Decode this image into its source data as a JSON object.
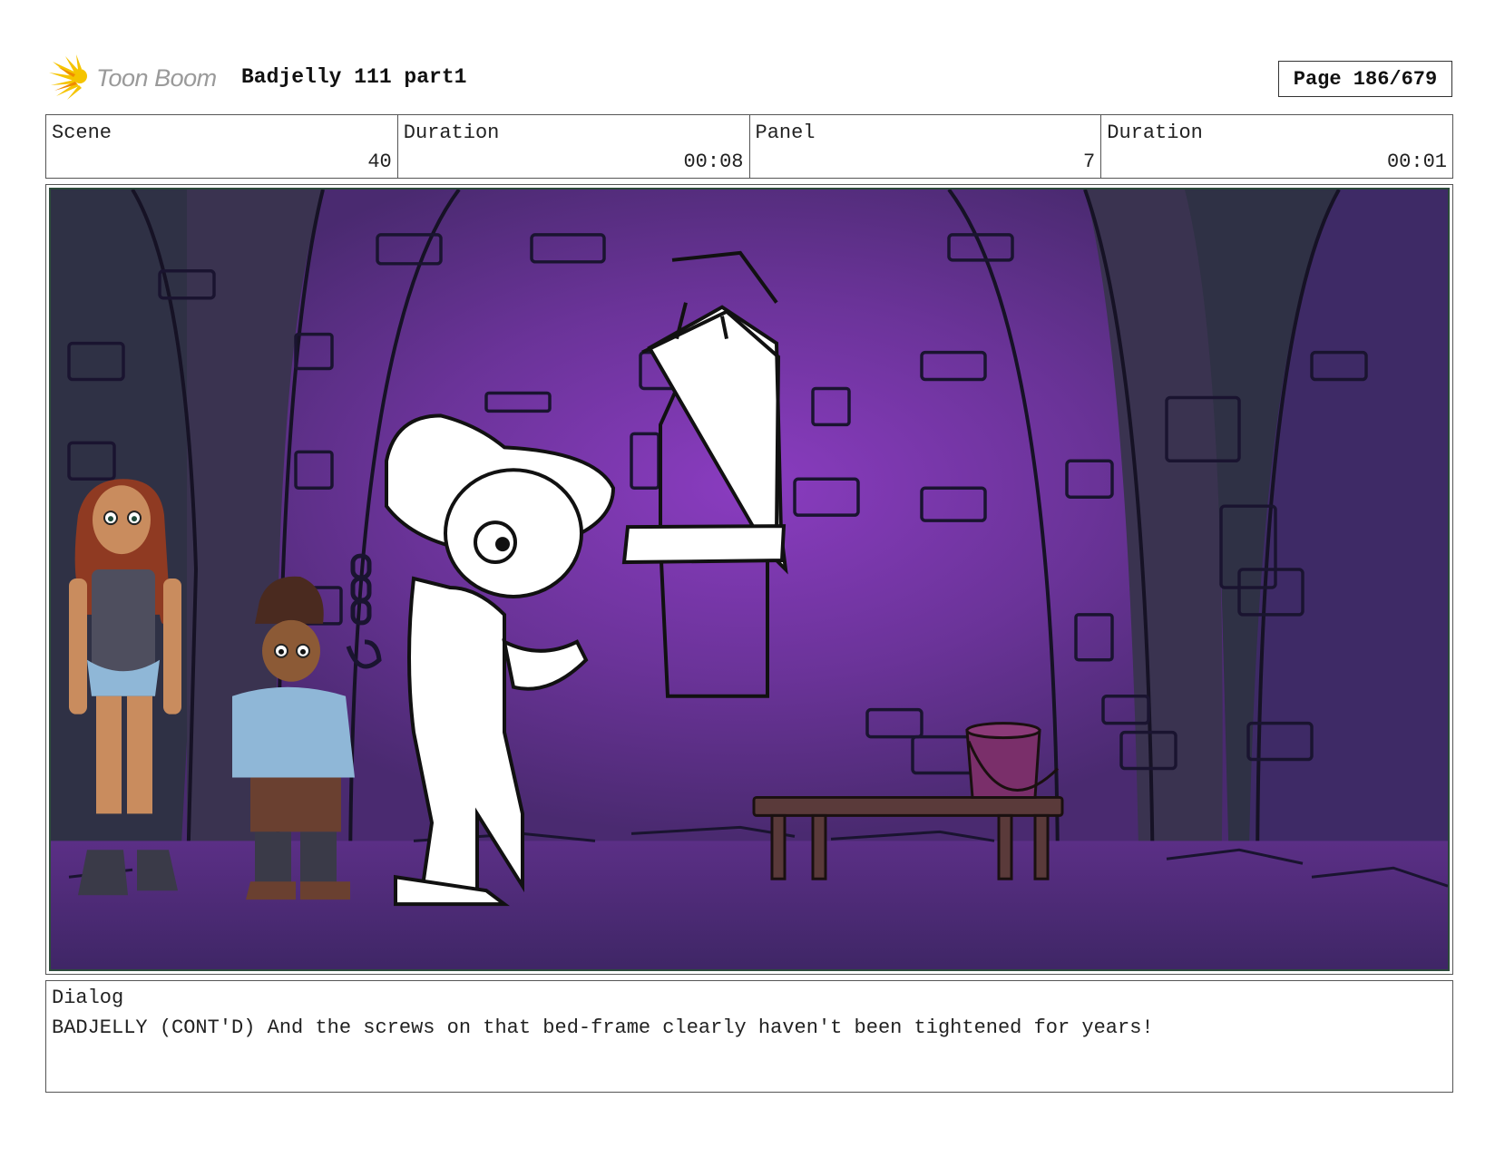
{
  "header": {
    "logo_text": "Toon Boom",
    "project_title": "Badjelly 111 part1",
    "page_label": "Page 186/679"
  },
  "info": {
    "scene_label": "Scene",
    "scene_value": "40",
    "scene_duration_label": "Duration",
    "scene_duration_value": "00:08",
    "panel_label": "Panel",
    "panel_value": "7",
    "panel_duration_label": "Duration",
    "panel_duration_value": "00:01"
  },
  "dialog": {
    "label": "Dialog",
    "text": "BADJELLY (CONT'D) And the screws on that bed-frame clearly haven't been tightened for years!"
  },
  "colors": {
    "wall_purple": "#5a2f86",
    "glow_purple": "#8a3cc0",
    "pillar_dark": "#2f3145",
    "floor_purple": "#4d2a78"
  }
}
